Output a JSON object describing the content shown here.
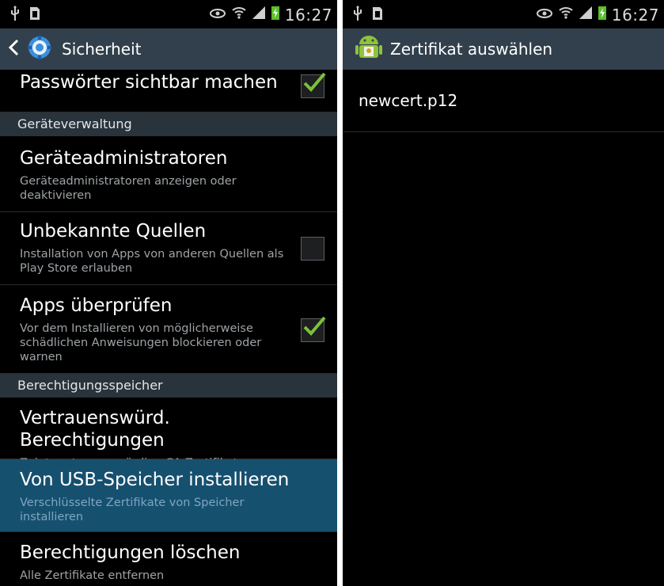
{
  "status_bar": {
    "time": "16:27",
    "icons": [
      "usb-icon",
      "sd-card-icon",
      "eye-icon",
      "wifi-icon",
      "signal-icon",
      "battery-charging-icon"
    ]
  },
  "left": {
    "title": "Sicherheit",
    "items": [
      {
        "title": "Passwörter sichtbar machen",
        "checked": true
      },
      {
        "header": "Geräteverwaltung"
      },
      {
        "title": "Geräteadministratoren",
        "subtitle": "Geräteadministratoren anzeigen oder deaktivieren"
      },
      {
        "title": "Unbekannte Quellen",
        "subtitle": "Installation von Apps von anderen Quellen als Play Store erlauben",
        "checked": false
      },
      {
        "title": "Apps überprüfen",
        "subtitle": "Vor dem Installieren von möglicherweise schädlichen Anweisungen blockieren oder warnen",
        "checked": true
      },
      {
        "header": "Berechtigungsspeicher"
      },
      {
        "title": "Vertrauenswürd. Berechtigungen",
        "subtitle": "Zeigt vertrauenswürdige CA-Zertifikate an"
      },
      {
        "title": "Von USB-Speicher installieren",
        "subtitle": "Verschlüsselte Zertifikate von Speicher installieren",
        "selected": true
      },
      {
        "title": "Berechtigungen löschen",
        "subtitle": "Alle Zertifikate entfernen"
      }
    ]
  },
  "right": {
    "title": "Zertifikat auswählen",
    "files": [
      "newcert.p12"
    ]
  },
  "colors": {
    "action_bar": "#31404c",
    "section_header": "#29333b",
    "selected_row": "#16506f",
    "check": "#7bc13a"
  }
}
